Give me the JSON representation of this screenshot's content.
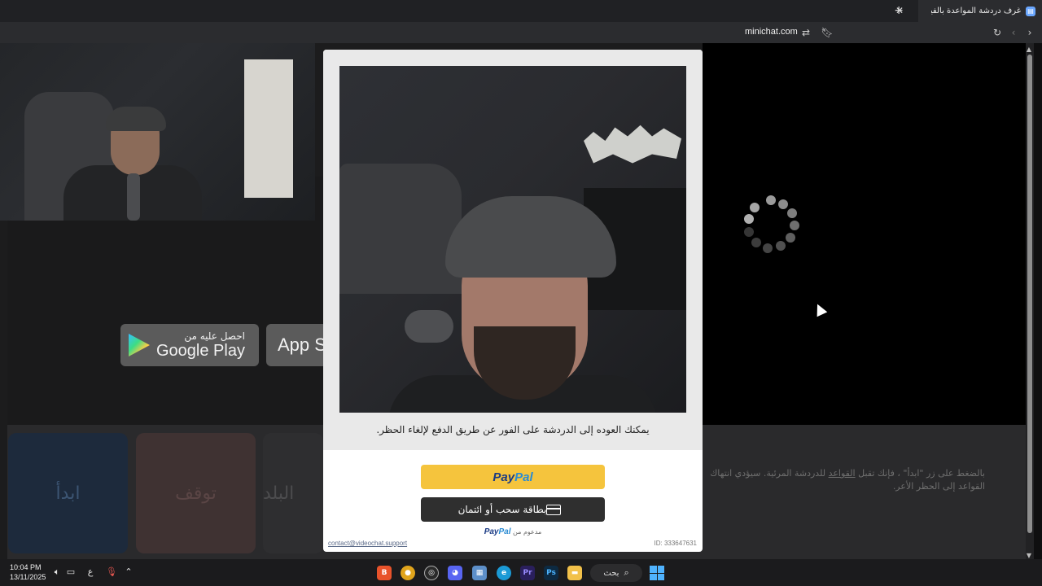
{
  "browser": {
    "tab_title": "غرف دردشة المواعدة بالفيديو من ا",
    "url": "minichat.com"
  },
  "page": {
    "google_play_small": "احصل عليه من",
    "google_play_big": "Google Play",
    "app_store_partial": "App S",
    "start_label": "ابدأ",
    "stop_label": "توقف",
    "country_label": "البلد",
    "rules_text_part1": "بالضغط على زر \"ابدأ\" ، فإنك تقبل ",
    "rules_link": "القواعد",
    "rules_text_part2": " للدردشة المرئية. سيؤدي انتهاك القواعد إلى الحظر الأعر."
  },
  "modal": {
    "message": "يمكنك العوده إلى الدردشة على الفور عن طريق الدفع لإلغاء الحظر.",
    "paypal_dark": "Pay",
    "paypal_light": "Pal",
    "card_button": "بطاقة سحب أو ائتمان",
    "powered_by": "مدعوم من",
    "contact": "contact@videochat.support",
    "id": "ID: 333647631"
  },
  "taskbar": {
    "time": "10:04 PM",
    "date": "13/11/2025",
    "lang": "ع",
    "search": "بحث"
  },
  "colors": {
    "paypal_yellow": "#f5c43d",
    "paypal_dark_blue": "#1a3a84",
    "paypal_light_blue": "#2a8bd3",
    "card_button": "#2f2f2f"
  }
}
